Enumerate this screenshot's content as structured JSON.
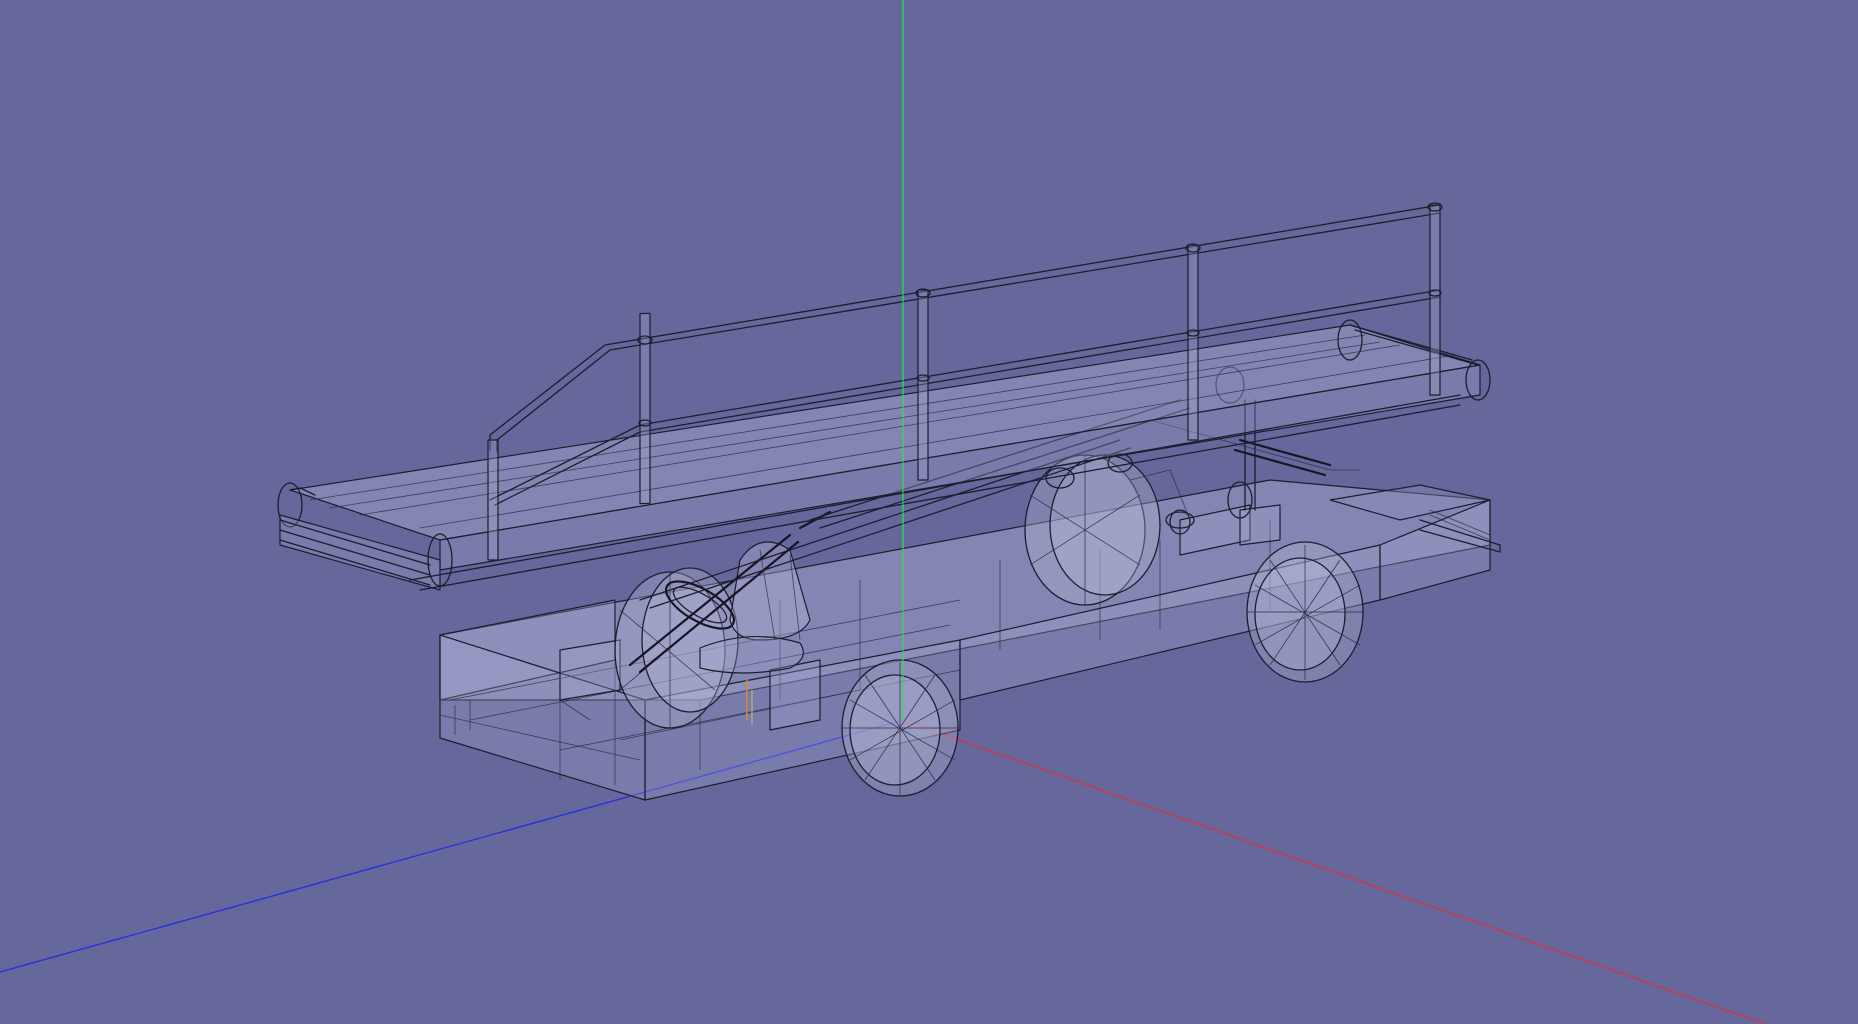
{
  "viewport": {
    "background": "#66679a",
    "axes": {
      "x": {
        "color": "#d2344a"
      },
      "y": {
        "color": "#2ed05a"
      },
      "z": {
        "color": "#2b30e0"
      }
    },
    "model": {
      "render_mode": "wireframe-transparent",
      "wire_color": "#1d1d30",
      "fill_color": "#a7a8cf"
    }
  }
}
